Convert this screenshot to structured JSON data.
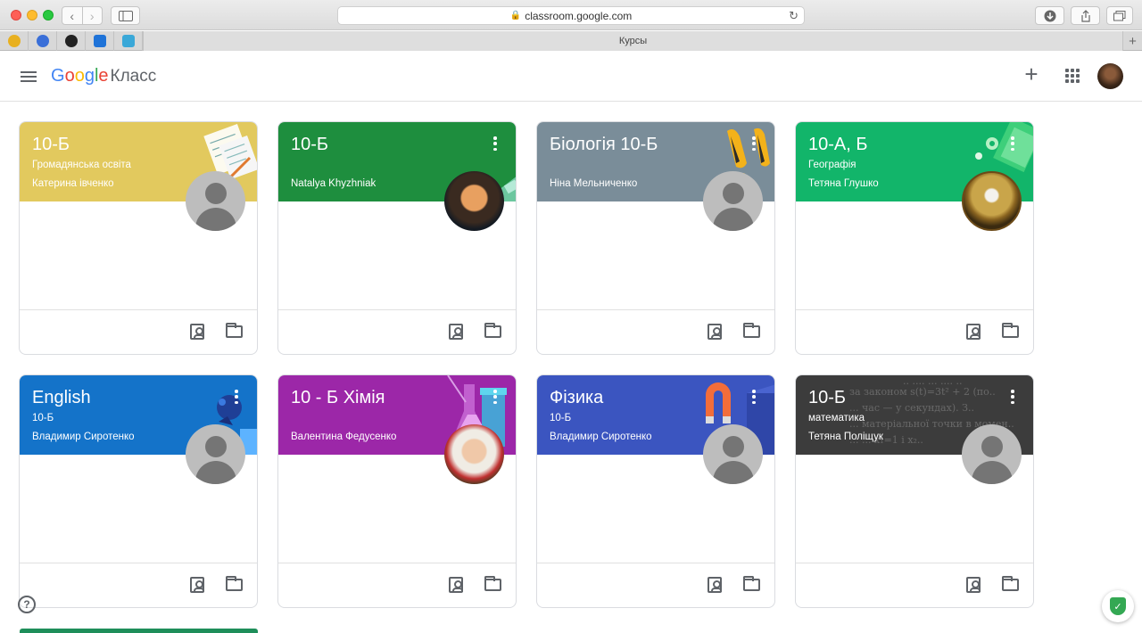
{
  "browser": {
    "url": "classroom.google.com",
    "tab_title": "Курсы"
  },
  "header": {
    "brand_google": [
      "G",
      "o",
      "o",
      "g",
      "l",
      "e"
    ],
    "brand_product": "Класс"
  },
  "courses": [
    {
      "title": "10-Б",
      "subtitle": "Громадянська освіта",
      "teacher": "Катерина івченко",
      "color": "#e2c95e",
      "avatar": "default",
      "has_menu": false
    },
    {
      "title": "10-Б",
      "subtitle": "",
      "teacher": "Natalya Khyzhniak",
      "color": "#1e8e3e",
      "avatar": "photo",
      "has_menu": true
    },
    {
      "title": "Біологія 10-Б",
      "subtitle": "",
      "teacher": "Ніна Мельниченко",
      "color": "#7a8d99",
      "avatar": "default",
      "has_menu": true
    },
    {
      "title": "10-А, Б",
      "subtitle": "Географія",
      "teacher": "Тетяна Глушко",
      "color": "#12b56a",
      "avatar": "photo",
      "has_menu": true
    },
    {
      "title": "English",
      "subtitle": "10-Б",
      "teacher": "Владимир Сиротенко",
      "color": "#1473c9",
      "avatar": "default",
      "has_menu": true
    },
    {
      "title": "10 - Б Хімія",
      "subtitle": "",
      "teacher": "Валентина Федусенко",
      "color": "#9c27a8",
      "avatar": "photo",
      "has_menu": true
    },
    {
      "title": "Фізика",
      "subtitle": "10-Б",
      "teacher": "Владимир Сиротенко",
      "color": "#3b55c0",
      "avatar": "default",
      "has_menu": true
    },
    {
      "title": "10-Б",
      "subtitle": "математика",
      "teacher": "Тетяна Поліщук",
      "color": "#3c3c3c",
      "avatar": "default",
      "has_menu": true
    }
  ],
  "help_icon": "?",
  "shield_mark": "✓"
}
